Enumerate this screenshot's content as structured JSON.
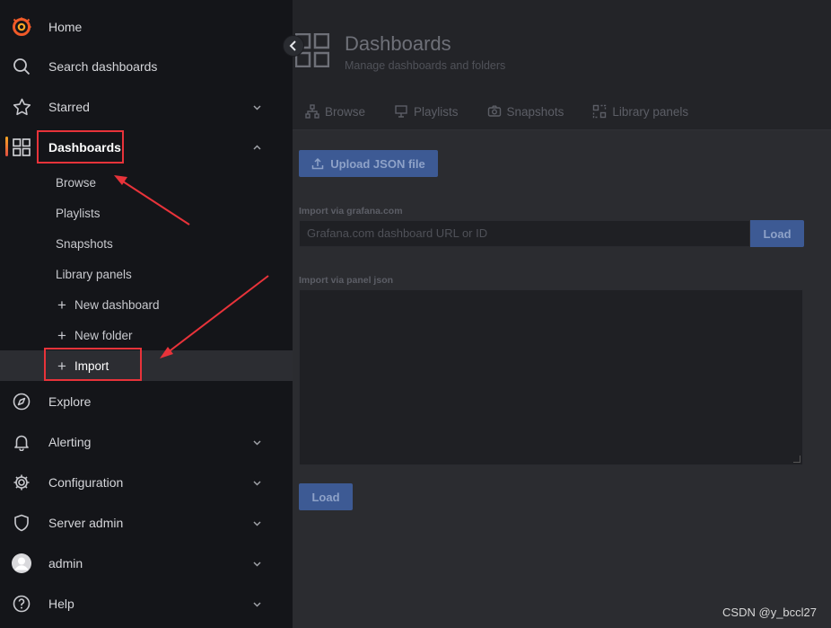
{
  "sidebar": {
    "home": "Home",
    "search": "Search dashboards",
    "starred": "Starred",
    "dashboards": "Dashboards",
    "dashboard_items": [
      "Browse",
      "Playlists",
      "Snapshots",
      "Library panels"
    ],
    "new_dashboard": "New dashboard",
    "new_folder": "New folder",
    "import": "Import",
    "explore": "Explore",
    "alerting": "Alerting",
    "configuration": "Configuration",
    "server_admin": "Server admin",
    "user": "admin",
    "help": "Help"
  },
  "page": {
    "title": "Dashboards",
    "subtitle": "Manage dashboards and folders",
    "tabs": [
      "Browse",
      "Playlists",
      "Snapshots",
      "Library panels"
    ]
  },
  "import": {
    "upload_label": "Upload JSON file",
    "grafana_label": "Import via grafana.com",
    "url_placeholder": "Grafana.com dashboard URL or ID",
    "load_label": "Load",
    "panel_json_label": "Import via panel json",
    "load2_label": "Load"
  },
  "watermark": "CSDN @y_bccl27",
  "colors": {
    "highlight": "#e8333a",
    "primary_button": "#3d5a94",
    "sidebar_bg": "#141519"
  }
}
